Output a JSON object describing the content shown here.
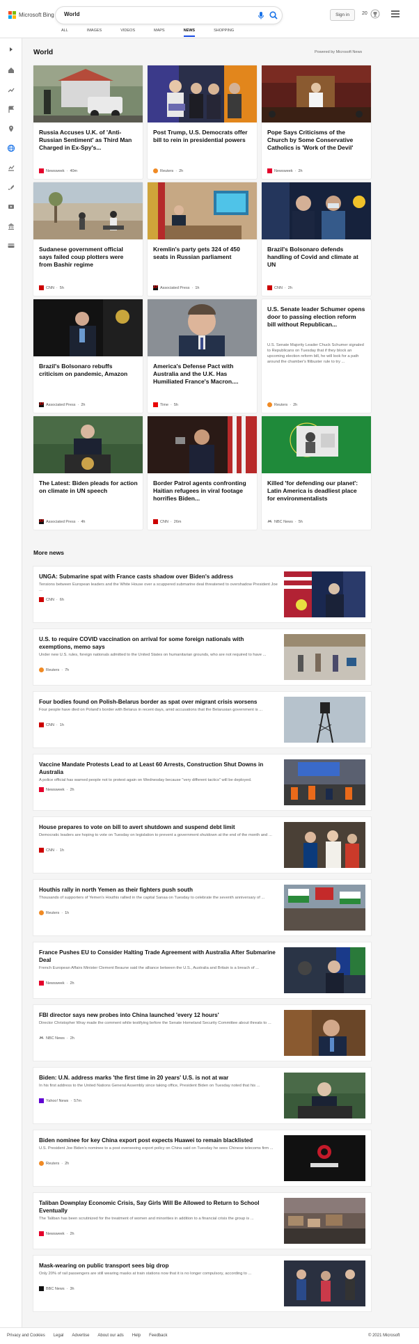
{
  "app": {
    "brand": "Microsoft Bing"
  },
  "search": {
    "query": "World"
  },
  "header": {
    "signin_label": "Sign in",
    "rewards_points": "20"
  },
  "tabs": [
    {
      "label": "ALL"
    },
    {
      "label": "IMAGES"
    },
    {
      "label": "VIDEOS"
    },
    {
      "label": "MAPS"
    },
    {
      "label": "NEWS",
      "active": true
    },
    {
      "label": "SHOPPING"
    }
  ],
  "section": {
    "title": "World",
    "powered_by": "Powered by Microsoft News"
  },
  "cards": [
    {
      "title": "Russia Accuses U.K. of 'Anti-Russian Sentiment' as Third Man Charged in Ex-Spy's...",
      "source": "Newsweek",
      "time": "40m",
      "source_icon": "newsweek-icon"
    },
    {
      "title": "Post Trump, U.S. Democrats offer bill to rein in presidential powers",
      "source": "Reuters",
      "time": "2h",
      "source_icon": "reuters-icon"
    },
    {
      "title": "Pope Says Criticisms of the Church by Some Conservative Catholics is 'Work of the Devil'",
      "source": "Newsweek",
      "time": "2h",
      "source_icon": "newsweek-icon"
    },
    {
      "title": "Sudanese government official says failed coup plotters were from Bashir regime",
      "source": "CNN",
      "time": "5h",
      "source_icon": "cnn-icon"
    },
    {
      "title": "Kremlin's party gets 324 of 450 seats in Russian parliament",
      "source": "Associated Press",
      "time": "1h",
      "source_icon": "ap-icon"
    },
    {
      "title": "Brazil's Bolsonaro defends handling of Covid and climate at UN",
      "source": "CNN",
      "time": "2h",
      "source_icon": "cnn-icon"
    },
    {
      "title": "Brazil's Bolsonaro rebuffs criticism on pandemic, Amazon",
      "source": "Associated Press",
      "time": "2h",
      "source_icon": "ap-icon"
    },
    {
      "title": "America's Defense Pact with Australia and the U.K. Has Humiliated France's Macron....",
      "source": "Time",
      "time": "5h",
      "source_icon": "time-icon"
    },
    {
      "title": "U.S. Senate leader Schumer opens door to passing election reform bill without Republican...",
      "description": "U.S. Senate Majority Leader Chuck Schumer signaled to Republicans on Tuesday that if they block an upcoming election reform bill, he will look for a path around the chamber's filibuster rule to try ...",
      "source": "Reuters",
      "time": "2h",
      "source_icon": "reuters-icon"
    },
    {
      "title": "The Latest: Biden pleads for action on climate in UN speech",
      "source": "Associated Press",
      "time": "4h",
      "source_icon": "ap-icon"
    },
    {
      "title": "Border Patrol agents confronting Haitian refugees in viral footage horrifies Biden...",
      "source": "CNN",
      "time": "26m",
      "source_icon": "cnn-icon"
    },
    {
      "title": "Killed 'for defending our planet': Latin America is deadliest place for environmentalists",
      "source": "NBC News",
      "time": "5h",
      "source_icon": "nbc-icon"
    }
  ],
  "more_news": {
    "title": "More news",
    "items": [
      {
        "title": "UNGA: Submarine spat with France casts shadow over Biden's address",
        "description": "Tensions between European leaders and the White House over a scuppered submarine deal threatened to overshadow President Joe ...",
        "source": "CNN",
        "time": "6h",
        "source_icon": "cnn-icon"
      },
      {
        "title": "U.S. to require COVID vaccination on arrival for some foreign nationals with exemptions, memo says",
        "description": "Under new U.S. rules, foreign nationals admitted to the United States on humanitarian grounds, who are not required to have ...",
        "source": "Reuters",
        "time": "7h",
        "source_icon": "reuters-icon"
      },
      {
        "title": "Four bodies found on Polish-Belarus border as spat over migrant crisis worsens",
        "description": "Four people have died on Poland's border with Belarus in recent days, amid accusations that the Belarusian government is ...",
        "source": "CNN",
        "time": "1h",
        "source_icon": "cnn-icon"
      },
      {
        "title": "Vaccine Mandate Protests Lead to at Least 60 Arrests, Construction Shut Downs in Australia",
        "description": "A police official has warned people not to protest again on Wednesday because \"very different tactics\" will be deployed.",
        "source": "Newsweek",
        "time": "2h",
        "source_icon": "newsweek-icon"
      },
      {
        "title": "House prepares to vote on bill to avert shutdown and suspend debt limit",
        "description": "Democratic leaders are hoping to vote on Tuesday on legislation to prevent a government shutdown at the end of the month and ...",
        "source": "CNN",
        "time": "1h",
        "source_icon": "cnn-icon"
      },
      {
        "title": "Houthis rally in north Yemen as their fighters push south",
        "description": "Thousands of supporters of Yemen's Houthis rallied in the capital Sanaa on Tuesday to celebrate the seventh anniversary of ...",
        "source": "Reuters",
        "time": "1h",
        "source_icon": "reuters-icon"
      },
      {
        "title": "France Pushes EU to Consider Halting Trade Agreement with Australia After Submarine Deal",
        "description": "French European Affairs Minister Clement Beaune said the alliance between the U.S., Australia and Britain is a breach of ...",
        "source": "Newsweek",
        "time": "2h",
        "source_icon": "newsweek-icon"
      },
      {
        "title": "FBI director says new probes into China launched 'every 12 hours'",
        "description": "Director Christopher Wray made the comment while testifying before the Senate Homeland Security Committee about threats to ...",
        "source": "NBC News",
        "time": "2h",
        "source_icon": "nbc-icon"
      },
      {
        "title": "Biden: U.N. address marks 'the first time in 20 years' U.S. is not at war",
        "description": "In his first address to the United Nations General Assembly since taking office, President Biden on Tuesday noted that his ...",
        "source": "Yahoo! News",
        "time": "57m",
        "source_icon": "yahoo-icon"
      },
      {
        "title": "Biden nominee for key China export post expects Huawei to remain blacklisted",
        "description": "U.S. President Joe Biden's nominee to a post overseeing export policy on China said on Tuesday he sees Chinese telecoms firm ...",
        "source": "Reuters",
        "time": "2h",
        "source_icon": "reuters-icon"
      },
      {
        "title": "Taliban Downplay Economic Crisis, Say Girls Will Be Allowed to Return to School Eventually",
        "description": "The Taliban has been scrutinized for the treatment of women and minorities in addition to a financial crisis the group is ...",
        "source": "Newsweek",
        "time": "2h",
        "source_icon": "newsweek-icon"
      },
      {
        "title": "Mask-wearing on public transport sees big drop",
        "description": "Only 20% of rail passengers are still wearing masks at train stations now that it is no longer compulsory, according to ...",
        "source": "BBC News",
        "time": "3h",
        "source_icon": "bbc-icon"
      }
    ]
  },
  "footer": {
    "links": [
      "Privacy and Cookies",
      "Legal",
      "Advertise",
      "About our ads",
      "Help",
      "Feedback"
    ],
    "copyright": "© 2021 Microsoft"
  },
  "colors": {
    "accent": "#174ae4",
    "newsweek": "#e4002b",
    "cnn": "#cc0000",
    "reuters": "#f08a24"
  }
}
